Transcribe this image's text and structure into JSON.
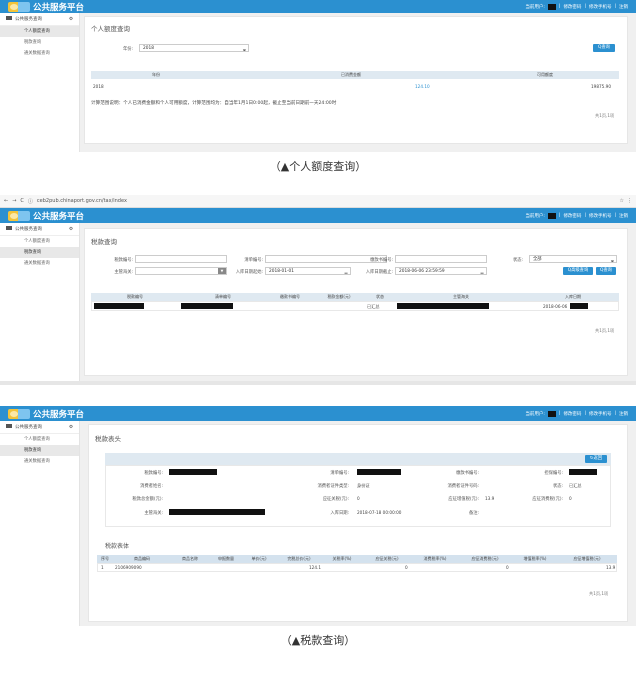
{
  "app": {
    "brand": "公共服务平台",
    "user_prefix": "当前用户:",
    "links": [
      "修改密码",
      "修改手机号",
      "注销"
    ],
    "sidebar_title": "公共服务查询",
    "sidebar_items": [
      "个人额度查询",
      "税款查询",
      "通关数据查询"
    ]
  },
  "shot1": {
    "page_title": "个人额度查询",
    "year_label": "年份:",
    "year_value": "2018",
    "query_button": "Q查询",
    "table_headers": [
      "年份",
      "已消费金额",
      "可用额度"
    ],
    "row": {
      "year": "2018",
      "spent": "124.10",
      "available": "19875.90"
    },
    "note": "计算范围说明：个人已消费金额和个人可用额度，计算范围均为：自当年1月1日0:00起，截止至当前日期前一天24:00时",
    "pager": "共1页,1项"
  },
  "caption1": "（▲个人额度查询）",
  "shot2": {
    "url": "ceb2pub.chinaport.gov.cn/tax/index",
    "page_title": "税款查询",
    "labels": {
      "tax_no": "税款编号:",
      "list_no": "清单编号:",
      "order_no": "缴款书编号:",
      "status": "状态:",
      "customs": "主管海关:",
      "date_start": "入库日期起始:",
      "date_end": "入库日期截止:"
    },
    "status_value": "全部",
    "date_start_value": "2018-01-01",
    "date_end_value": "2018-06-06 23:59:59",
    "buttons": [
      "Q高级查询",
      "Q查询"
    ],
    "table_headers": [
      "税款编号",
      "清单编号",
      "缴款书编号",
      "税款金额(元)",
      "状态",
      "主管海关",
      "入库日期"
    ],
    "row": {
      "status": "已汇总",
      "date": "2018-06-06"
    },
    "pager": "共1页,1项"
  },
  "shot3": {
    "header_title": "税款表头",
    "return_button": "返回",
    "fields": {
      "tax_no": "税款编号:",
      "list_no": "清单编号:",
      "order_no": "缴款书编号:",
      "guarantor_no": "担保编号:",
      "consumer_name": "消费者姓名:",
      "id_type": "消费者证件类型:",
      "id_type_value": "身份证",
      "id_no": "消费者证件号码:",
      "status": "状态:",
      "status_value": "已汇总",
      "tariff": "应征关税(元):",
      "vat": "应征增值税(元):",
      "vat_value": "13.9",
      "consumption_tax": "应征消费税(元):",
      "consumption_tax_value": "0",
      "total": "税款总金额(元):",
      "customs": "主管海关:",
      "in_date": "入库日期:",
      "in_date_value": "2018-07-18 00:00:00",
      "remark": "备注:",
      "tariff_value": "0"
    },
    "body_title": "税款表体",
    "body_headers": [
      "序号",
      "商品编码",
      "商品名称",
      "申报数量",
      "单价(元)",
      "完税总价(元)",
      "关税率(%)",
      "应征关税(元)",
      "消费税率(%)",
      "应征消费税(元)",
      "增值税率(%)",
      "应征增值税(元)"
    ],
    "body_row": [
      "1",
      "2106909090",
      "",
      "",
      "",
      "124.1",
      "",
      "0",
      "",
      "0",
      "",
      "13.9"
    ],
    "pager": "共1页,1项"
  },
  "caption2": "（▲税款查询）"
}
